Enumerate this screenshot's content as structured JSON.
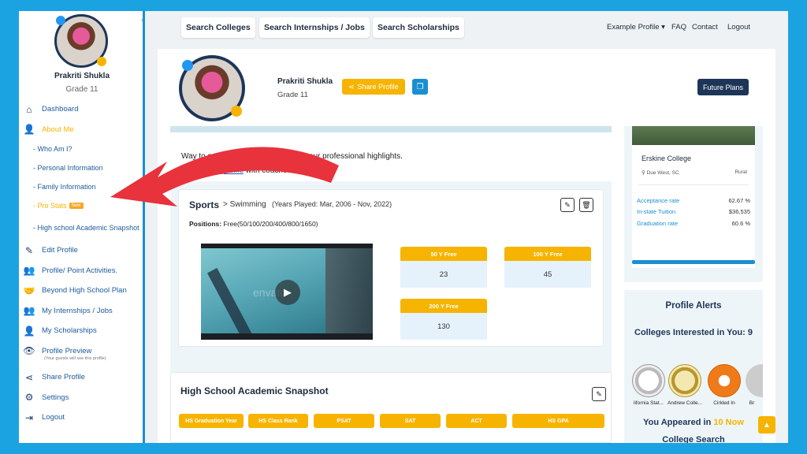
{
  "sidebar": {
    "user_name": "Prakriti Shukla",
    "user_grade": "Grade 11",
    "collapse_icon": "‹",
    "items": [
      {
        "label": "Dashboard",
        "icon": "home-icon",
        "glyph": "⌂"
      },
      {
        "label": "About Me",
        "icon": "user-icon",
        "glyph": "👤"
      }
    ],
    "sub_items": [
      {
        "label": "- Who Am I?"
      },
      {
        "label": "- Personal Information"
      },
      {
        "label": "- Family Information"
      },
      {
        "label": "- Pro Stats",
        "badge": "New"
      },
      {
        "label": "- High school Academic Snapshot"
      }
    ],
    "items2": [
      {
        "label": "Edit Profile",
        "icon": "edit-icon",
        "glyph": "✎"
      },
      {
        "label": "Profile/ Point Activities.",
        "icon": "users-icon",
        "glyph": "👥"
      },
      {
        "label": "Beyond High School Plan",
        "icon": "handshake-icon",
        "glyph": "🤝"
      },
      {
        "label": "My Internships / Jobs",
        "icon": "users-icon",
        "glyph": "👥"
      },
      {
        "label": "My Scholarships",
        "icon": "user-icon",
        "glyph": "👤"
      },
      {
        "label": "Profile Preview",
        "icon": "eye-icon",
        "glyph": "👁"
      }
    ],
    "preview_note": "(Your guests will see this profile)",
    "items3": [
      {
        "label": "Share Profile",
        "icon": "share-icon",
        "glyph": "⋖"
      },
      {
        "label": "Settings",
        "icon": "gears-icon",
        "glyph": "⚙"
      },
      {
        "label": "Logout",
        "icon": "logout-icon",
        "glyph": "⇥"
      }
    ]
  },
  "topbar": {
    "buttons": [
      "Search Colleges",
      "Search Internships / Jobs",
      "Search Scholarships"
    ],
    "links": [
      "Example Profile ▾",
      "FAQ",
      "Contact",
      "Logout"
    ]
  },
  "profile": {
    "name": "Prakriti Shukla",
    "grade": "Grade 11",
    "share_label": "Share Profile",
    "future_label": "Future Plans"
  },
  "intro": {
    "line1": "Way to go! Great way to showcase your professional highlights.",
    "link": "Share your profile",
    "line2": " with coaches."
  },
  "sports": {
    "title": "Sports",
    "sub": "> Swimming",
    "years": "(Years Played: Mar, 2006 - Nov, 2022)",
    "positions_label": "Positions:",
    "positions_value": "Free(50/100/200/400/800/1650)",
    "watermark": "envato",
    "stats": [
      {
        "label": "50 Y Free",
        "value": "23"
      },
      {
        "label": "100 Y Free",
        "value": "45"
      },
      {
        "label": "200 Y Free",
        "value": "130"
      }
    ]
  },
  "hs": {
    "title": "High School Academic Snapshot",
    "headers": [
      "HS Graduation Year",
      "HS Class Rank",
      "PSAT",
      "SAT",
      "ACT",
      "HS GPA"
    ]
  },
  "college": {
    "name": "Erskine College",
    "location": "Due West, SC",
    "type": "Rural",
    "stats": [
      {
        "k": "Acceptance rate",
        "v": "62.67 %"
      },
      {
        "k": "In-state Tuition",
        "v": "$36,535"
      },
      {
        "k": "Graduation rate",
        "v": "60.6 %"
      }
    ]
  },
  "alerts": {
    "title": "Profile Alerts",
    "interested": "Colleges Interested in You: 9",
    "seals": [
      "lifornia Stat...",
      "Andrew Colle...",
      "Cirkled In",
      "Br"
    ],
    "appeared_prefix": "You Appeared in ",
    "appeared_highlight": "10 Now",
    "appeared_suffix": "College Search"
  },
  "colors": {
    "accent": "#f6b400",
    "primary": "#1d3557",
    "blue": "#1a8fd0"
  }
}
